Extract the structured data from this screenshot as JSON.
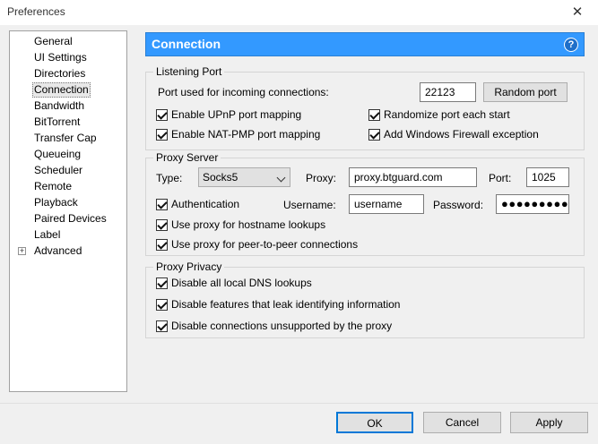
{
  "window": {
    "title": "Preferences",
    "close_glyph": "✕"
  },
  "tree": {
    "items": [
      {
        "label": "General"
      },
      {
        "label": "UI Settings"
      },
      {
        "label": "Directories"
      },
      {
        "label": "Connection",
        "selected": true
      },
      {
        "label": "Bandwidth"
      },
      {
        "label": "BitTorrent"
      },
      {
        "label": "Transfer Cap"
      },
      {
        "label": "Queueing"
      },
      {
        "label": "Scheduler"
      },
      {
        "label": "Remote"
      },
      {
        "label": "Playback"
      },
      {
        "label": "Paired Devices"
      },
      {
        "label": "Label"
      },
      {
        "label": "Advanced",
        "expandable": true,
        "expander": "+"
      }
    ]
  },
  "header": {
    "title": "Connection",
    "help_glyph": "?"
  },
  "listening_port": {
    "title": "Listening Port",
    "port_label": "Port used for incoming connections:",
    "port_value": "22123",
    "random_port_button": "Random port",
    "upnp": "Enable UPnP port mapping",
    "natpmp": "Enable NAT-PMP port mapping",
    "randomize": "Randomize port each start",
    "firewall": "Add Windows Firewall exception"
  },
  "proxy_server": {
    "title": "Proxy Server",
    "type_label": "Type:",
    "type_value": "Socks5",
    "proxy_label": "Proxy:",
    "proxy_value": "proxy.btguard.com",
    "port_label": "Port:",
    "port_value": "1025",
    "auth": "Authentication",
    "username_label": "Username:",
    "username_value": "username",
    "password_label": "Password:",
    "password_value": "●●●●●●●●●●",
    "hostname_lookups": "Use proxy for hostname lookups",
    "p2p": "Use proxy for peer-to-peer connections"
  },
  "proxy_privacy": {
    "title": "Proxy Privacy",
    "dns": "Disable all local DNS lookups",
    "leak": "Disable features that leak identifying information",
    "unsupported": "Disable connections unsupported by the proxy"
  },
  "footer": {
    "ok": "OK",
    "cancel": "Cancel",
    "apply": "Apply"
  },
  "colors": {
    "header_bg": "#3399ff",
    "header_text": "#ffffff"
  }
}
